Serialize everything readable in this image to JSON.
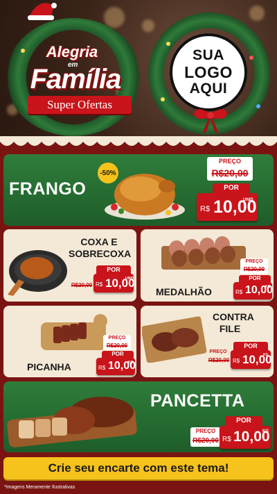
{
  "header": {
    "brand_line1": "Alegria",
    "brand_small": "em",
    "brand_line2": "Família",
    "ribbon": "Super Ofertas",
    "logo_lines": [
      "SUA",
      "LOGO",
      "AQUI"
    ]
  },
  "products": {
    "frango": {
      "name": "FRANGO",
      "discount_badge": "-50%",
      "price_label": "PREÇO",
      "old_price": "R$20,00",
      "por_label": "POR",
      "currency": "R$",
      "amount": "10,00",
      "unit": "UNID"
    },
    "coxa": {
      "name": "COXA E SOBRECOXA",
      "por_label": "POR",
      "old_price": "R$20,00",
      "currency": "R$",
      "amount": "10,00",
      "unit": "UNID"
    },
    "medalhao": {
      "name": "MEDALHÃO",
      "price_label": "PREÇO",
      "old_price": "R$20,00",
      "por_label": "POR",
      "currency": "R$",
      "amount": "10,00",
      "unit": "KG"
    },
    "picanha": {
      "name": "PICANHA",
      "price_label": "PREÇO",
      "old_price": "R$20,00",
      "por_label": "POR",
      "currency": "R$",
      "amount": "10,00",
      "unit": "KG"
    },
    "contrafile": {
      "name": "CONTRA FILE",
      "por_label": "POR",
      "price_label": "PREÇO",
      "old_price": "R$20,00",
      "currency": "R$",
      "amount": "10,00",
      "unit": "KG"
    },
    "pancetta": {
      "name": "PANCETTA",
      "por_label": "POR",
      "price_label": "PREÇO",
      "old_price": "R$20,00",
      "currency": "R$",
      "amount": "10,00",
      "unit": "KG"
    }
  },
  "cta": "Crie seu encarte com este tema!",
  "disclaimer": "*Imagens Meramente Ilustrativas",
  "colors": {
    "red": "#c8141a",
    "green": "#2f7d3a",
    "cream": "#f4e9d6",
    "yellow": "#f6c21c",
    "background": "#7a1412"
  }
}
